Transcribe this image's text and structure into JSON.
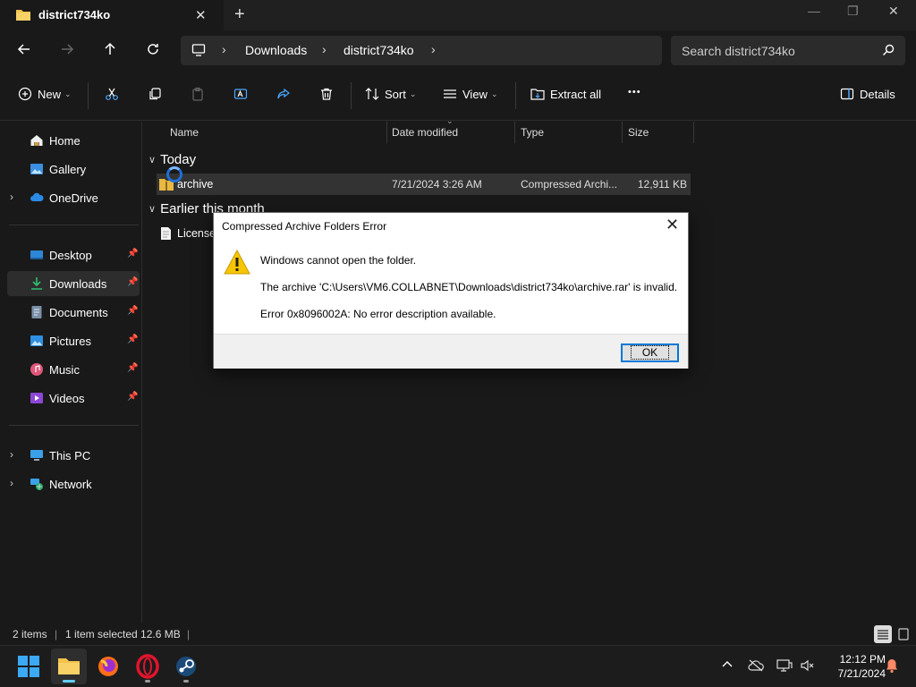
{
  "window": {
    "tab_title": "district734ko",
    "tab_close": "✕",
    "new_tab": "+"
  },
  "address": {
    "crumbs": [
      "Downloads",
      "district734ko"
    ],
    "search_placeholder": "Search district734ko"
  },
  "commands": {
    "new": "New",
    "sort": "Sort",
    "view": "View",
    "extract_all": "Extract all",
    "more": "•••",
    "details": "Details"
  },
  "sidebar": {
    "items": [
      {
        "label": "Home"
      },
      {
        "label": "Gallery"
      },
      {
        "label": "OneDrive"
      },
      {
        "label": "Desktop"
      },
      {
        "label": "Downloads"
      },
      {
        "label": "Documents"
      },
      {
        "label": "Pictures"
      },
      {
        "label": "Music"
      },
      {
        "label": "Videos"
      },
      {
        "label": "This PC"
      },
      {
        "label": "Network"
      }
    ]
  },
  "files": {
    "columns": [
      "Name",
      "Date modified",
      "Type",
      "Size"
    ],
    "groups": [
      {
        "label": "Today",
        "rows": [
          {
            "name": "archive",
            "date": "7/21/2024 3:26 AM",
            "type": "Compressed Archi...",
            "size": "12,911 KB"
          }
        ]
      },
      {
        "label": "Earlier this month",
        "rows": [
          {
            "name": "License",
            "date": "",
            "type": "",
            "size": ""
          }
        ]
      }
    ]
  },
  "status": {
    "items": "2 items",
    "selected": "1 item selected  12.6 MB"
  },
  "dialog": {
    "title": "Compressed Archive Folders Error",
    "line1": "Windows cannot open the folder.",
    "line2": "The archive 'C:\\Users\\VM6.COLLABNET\\Downloads\\district734ko\\archive.rar' is invalid.",
    "line3": "Error 0x8096002A: No error description available.",
    "ok": "OK"
  },
  "taskbar": {
    "time": "12:12 PM",
    "date": "7/21/2024"
  },
  "colors": {
    "accent": "#60cdff",
    "folder": "#f2c24b",
    "warning": "#f7c600"
  }
}
